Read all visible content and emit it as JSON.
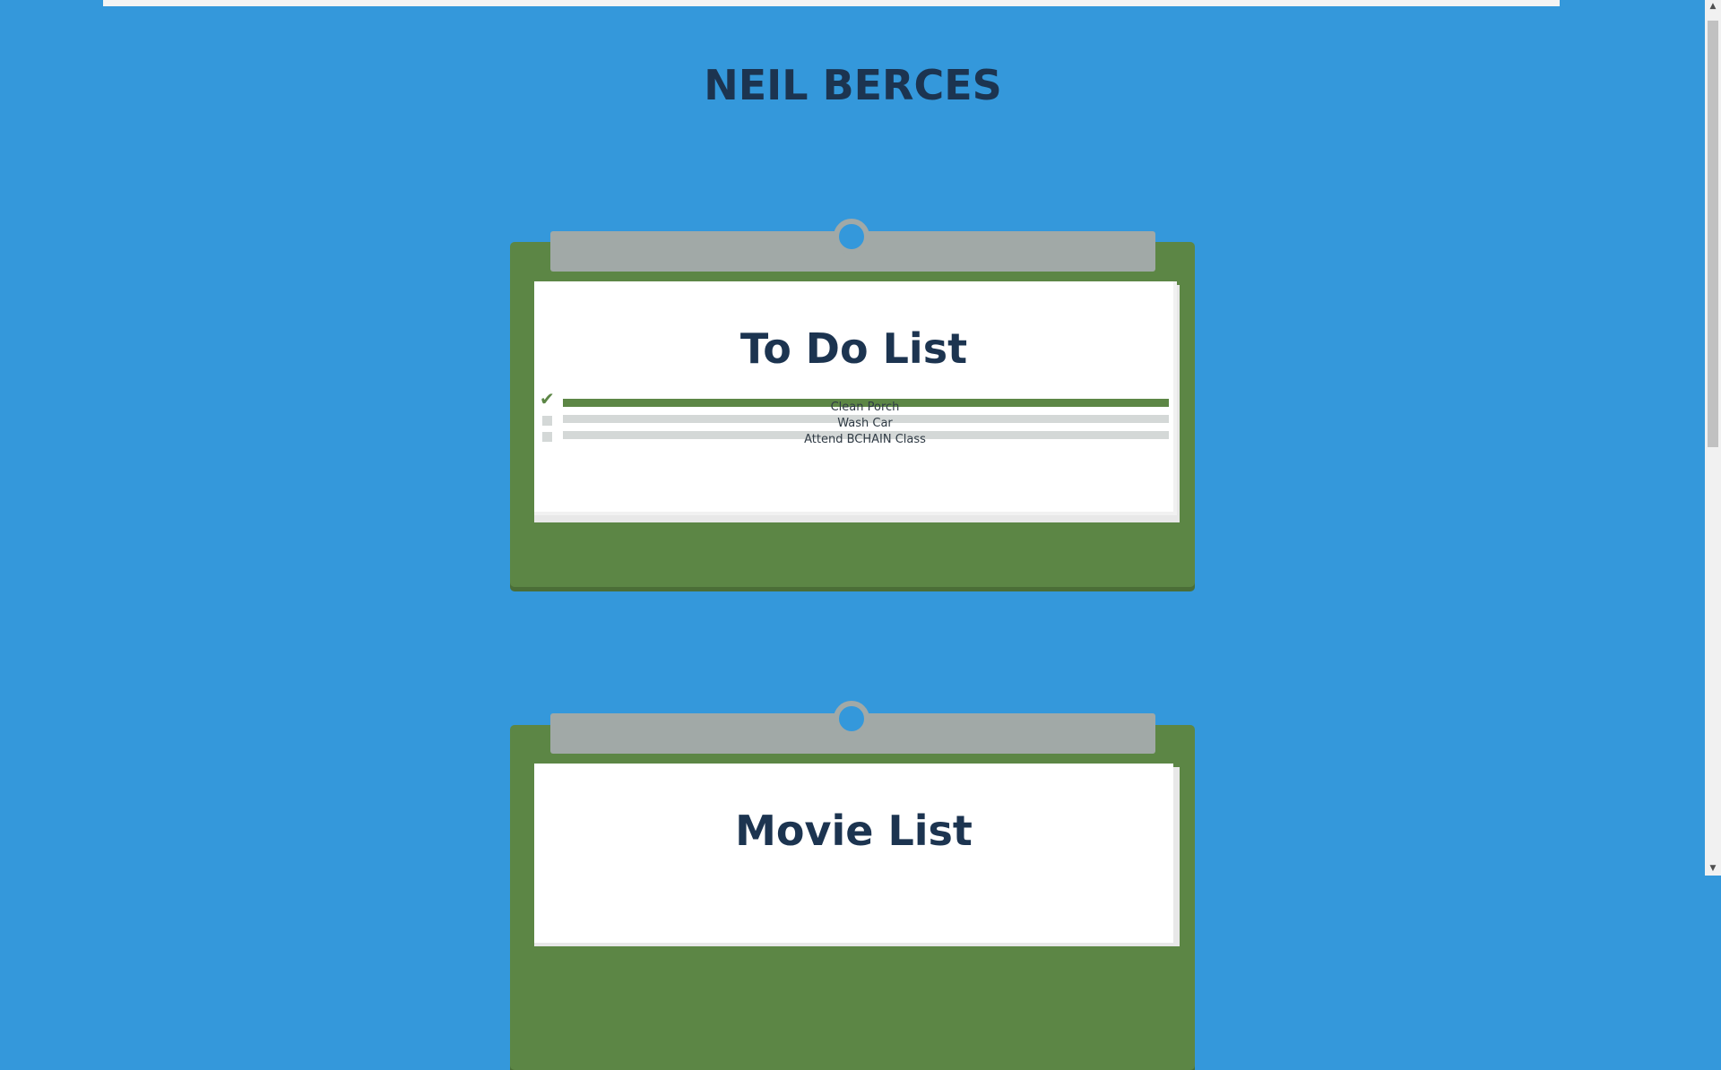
{
  "header": {
    "title": "NEIL BERCES"
  },
  "lists": [
    {
      "title": "To Do List",
      "items": [
        {
          "label": "Clean Porch",
          "done": true
        },
        {
          "label": "Wash Car",
          "done": false
        },
        {
          "label": "Attend BCHAIN Class",
          "done": false
        }
      ]
    },
    {
      "title": "Movie List"
    }
  ],
  "colors": {
    "background": "#3498db",
    "board": "#5c8645",
    "clip": "#a1a9a7",
    "title": "#1c3450",
    "done": "#5c8645",
    "pending": "#d4d8d7"
  },
  "icons": {
    "checked": "check-icon",
    "unchecked": "checkbox-empty-icon",
    "scroll_up": "scroll-up-arrow-icon",
    "scroll_down": "scroll-down-arrow-icon"
  }
}
